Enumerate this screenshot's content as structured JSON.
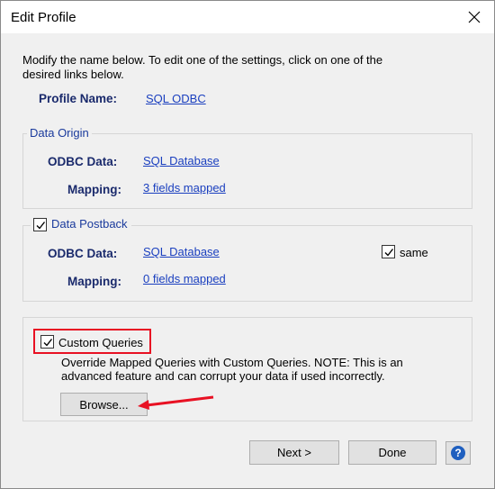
{
  "window": {
    "title": "Edit Profile"
  },
  "intro_text": "Modify the name below.  To edit one of the settings, click on one of the desired links below.",
  "profile": {
    "label": "Profile Name:",
    "value": "SQL ODBC"
  },
  "data_origin": {
    "legend": "Data Origin",
    "odbc_label": "ODBC Data:",
    "odbc_value": "SQL Database",
    "mapping_label": "Mapping:",
    "mapping_value": "3 fields mapped"
  },
  "data_postback": {
    "legend": "Data Postback",
    "checked": true,
    "odbc_label": "ODBC Data:",
    "odbc_value": "SQL Database",
    "mapping_label": "Mapping:",
    "mapping_value": "0 fields mapped",
    "same_label": "same",
    "same_checked": true
  },
  "custom_queries": {
    "label": "Custom Queries",
    "checked": true,
    "description": "Override Mapped Queries with Custom Queries. NOTE: This is an advanced feature and can corrupt your data if used incorrectly.",
    "browse_label": "Browse..."
  },
  "footer": {
    "next_label": "Next >",
    "done_label": "Done"
  },
  "annotation_color": "#e81123"
}
